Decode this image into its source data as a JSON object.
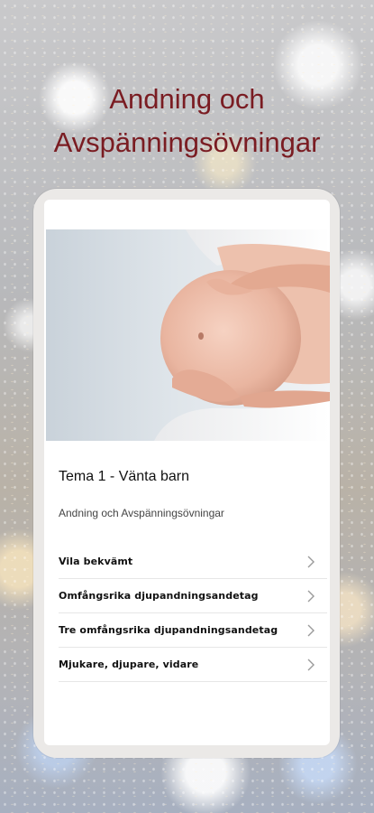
{
  "header": {
    "title_line1": "Andning och",
    "title_line2": "Avspänningsövningar"
  },
  "topic": {
    "title": "Tema 1 - Vänta barn",
    "subtitle": "Andning och Avspänningsövningar"
  },
  "exercises": [
    {
      "label": "Vila bekvämt",
      "icon": "chevron-right-icon"
    },
    {
      "label": "Omfångsrika djupandningsandetag",
      "icon": "chevron-right-icon"
    },
    {
      "label": "Tre omfångsrika djupandningsandetag",
      "icon": "chevron-right-icon"
    },
    {
      "label": "Mjukare, djupare, vidare",
      "icon": "chevron-right-icon"
    }
  ],
  "colors": {
    "title": "#7a1c22",
    "device_frame": "#ebe9e7",
    "divider": "#e6e6e6"
  }
}
